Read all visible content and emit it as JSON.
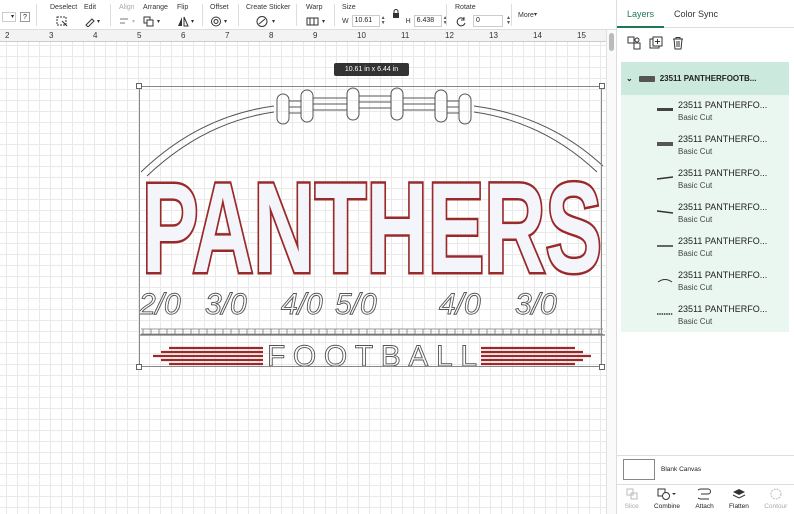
{
  "toolbar": {
    "deselect": "Deselect",
    "edit": "Edit",
    "align": "Align",
    "arrange": "Arrange",
    "flip": "Flip",
    "offset": "Offset",
    "create_sticker": "Create Sticker",
    "warp": "Warp",
    "size": "Size",
    "width_label": "W",
    "width_value": "10.61",
    "height_label": "H",
    "height_value": "6.438",
    "rotate": "Rotate",
    "rotate_value": "0",
    "more": "More",
    "more_caret": "▾",
    "question": "?"
  },
  "ruler": [
    "2",
    "3",
    "4",
    "5",
    "6",
    "7",
    "8",
    "9",
    "10",
    "11",
    "12",
    "13",
    "14",
    "15"
  ],
  "canvas": {
    "size_tooltip": "10.61  in x 6.44  in",
    "design": {
      "title": "PANTHERS",
      "subtitle": "FOOTBALL",
      "yard_numbers": [
        "2/0",
        "3/0",
        "4/0",
        "5/0",
        "4/0",
        "3/0"
      ],
      "colors": {
        "outline": "#9a2a2a",
        "fill": "#f4f4fb",
        "stroke": "#555555"
      }
    }
  },
  "panel": {
    "tabs": [
      "Layers",
      "Color Sync"
    ],
    "group_name": "23511 PANTHERFOOTB...",
    "layers": [
      {
        "name": "23511 PANTHERFO...",
        "op": "Basic Cut"
      },
      {
        "name": "23511 PANTHERFO...",
        "op": "Basic Cut"
      },
      {
        "name": "23511 PANTHERFO...",
        "op": "Basic Cut"
      },
      {
        "name": "23511 PANTHERFO...",
        "op": "Basic Cut"
      },
      {
        "name": "23511 PANTHERFO...",
        "op": "Basic Cut"
      },
      {
        "name": "23511 PANTHERFO...",
        "op": "Basic Cut"
      },
      {
        "name": "23511 PANTHERFO...",
        "op": "Basic Cut"
      }
    ],
    "blank_canvas": "Blank Canvas",
    "bottom": {
      "slice": "Slice",
      "combine": "Combine",
      "attach": "Attach",
      "flatten": "Flatten",
      "contour": "Contour"
    }
  }
}
